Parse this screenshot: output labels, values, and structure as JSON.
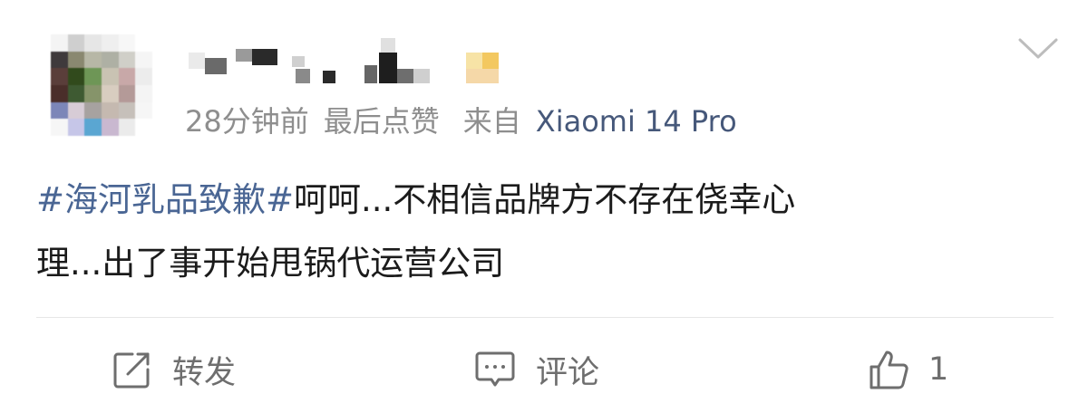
{
  "header": {
    "time": "28分钟前",
    "last_like": "最后点赞",
    "source_prefix": "来自",
    "device": "Xiaomi 14 Pro"
  },
  "content": {
    "topic": "#海河乳品致歉#",
    "line1_rest": "呵呵...不相信品牌方不存在侥幸心",
    "line2": "理...出了事开始甩锅代运营公司"
  },
  "actions": {
    "repost_label": "转发",
    "comment_label": "评论",
    "like_count": "1"
  },
  "icons": {
    "repost": "share-box-icon",
    "comment": "comment-bubble-icon",
    "like": "thumbs-up-icon",
    "menu": "chevron-down-icon"
  },
  "colors": {
    "topic_link": "#4a6694",
    "device_link": "#46587a",
    "meta_gray": "#8e8e8e",
    "body_text": "#1b1b1b",
    "action_gray": "#6e6e6e"
  }
}
